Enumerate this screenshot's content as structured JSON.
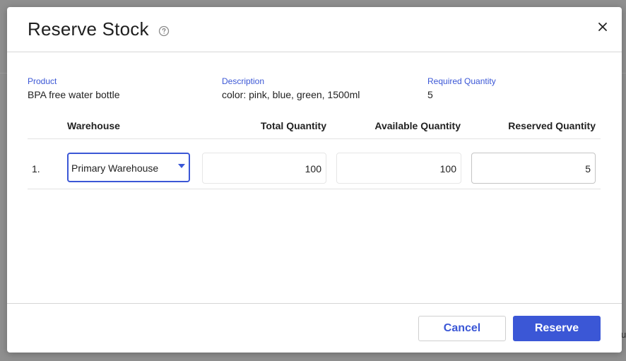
{
  "background": {
    "fragment_text": "u"
  },
  "dialog": {
    "title": "Reserve Stock",
    "help_icon": "question-circle-icon",
    "close_icon": "close-icon"
  },
  "product": {
    "label": "Product",
    "value": "BPA free water bottle"
  },
  "description": {
    "label": "Description",
    "value": "color: pink, blue, green, 1500ml"
  },
  "required_quantity": {
    "label": "Required Quantity",
    "value": "5"
  },
  "table": {
    "headers": {
      "warehouse": "Warehouse",
      "total": "Total Quantity",
      "available": "Available Quantity",
      "reserved": "Reserved Quantity"
    },
    "rows": [
      {
        "index": "1.",
        "warehouse": "Primary Warehouse",
        "total": "100",
        "available": "100",
        "reserved": "5"
      }
    ]
  },
  "buttons": {
    "cancel": "Cancel",
    "reserve": "Reserve"
  },
  "colors": {
    "accent": "#3b57d6",
    "overlay": "#8f8f8f"
  }
}
